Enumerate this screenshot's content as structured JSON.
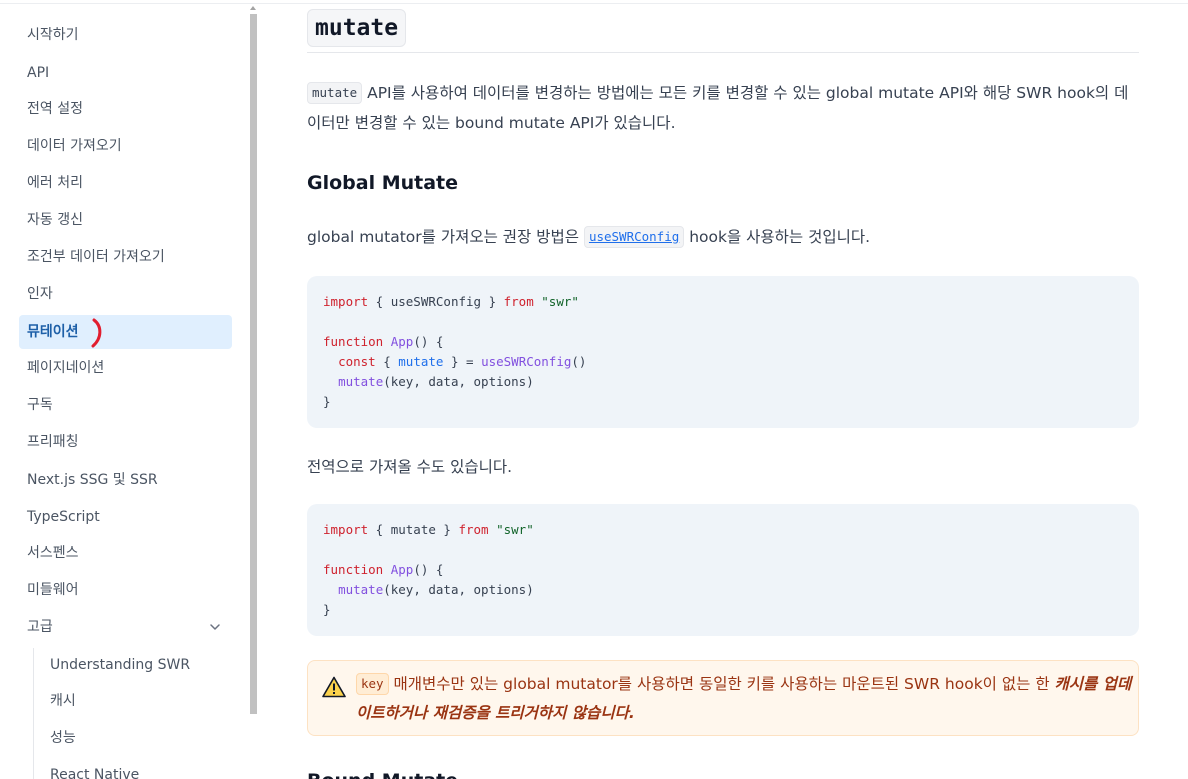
{
  "sidebar": {
    "items": [
      {
        "label": "시작하기"
      },
      {
        "label": "API"
      },
      {
        "label": "전역 설정"
      },
      {
        "label": "데이터 가져오기"
      },
      {
        "label": "에러 처리"
      },
      {
        "label": "자동 갱신"
      },
      {
        "label": "조건부 데이터 가져오기"
      },
      {
        "label": "인자"
      },
      {
        "label": "뮤테이션"
      },
      {
        "label": "페이지네이션"
      },
      {
        "label": "구독"
      },
      {
        "label": "프리패칭"
      },
      {
        "label": "Next.js SSG 및 SSR"
      },
      {
        "label": "TypeScript"
      },
      {
        "label": "서스펜스"
      },
      {
        "label": "미들웨어"
      },
      {
        "label": "고급"
      }
    ],
    "active_item": "뮤테이션",
    "subitems": [
      {
        "label": "Understanding SWR"
      },
      {
        "label": "캐시"
      },
      {
        "label": "성능"
      },
      {
        "label": "React Native"
      }
    ]
  },
  "main": {
    "title": "mutate",
    "intro": {
      "code": "mutate",
      "text": "API를 사용하여 데이터를 변경하는 방법에는 모든 키를 변경할 수 있는 global mutate API와 해당 SWR hook의 데이터만 변경할 수 있는 bound mutate API가 있습니다."
    },
    "global_heading": "Global Mutate",
    "global_para": {
      "before": "global mutator를 가져오는 권장 방법은 ",
      "code": "useSWRConfig",
      "after": " hook을 사용하는 것입니다."
    },
    "code1": {
      "import_kw": "import",
      "import_mid": " { useSWRConfig } ",
      "from_kw": "from",
      "module": "\"swr\"",
      "func_kw": "function",
      "func_name": "App",
      "func_sig": "() {",
      "const_kw": "const",
      "destr_open": " { ",
      "destr_var": "mutate",
      "destr_close": " } = ",
      "hook_call": "useSWRConfig",
      "hook_parens": "()",
      "call_name": "mutate",
      "call_args": "(key, data, options)",
      "close": "}"
    },
    "global_para2": "전역으로 가져올 수도 있습니다.",
    "code2": {
      "import_kw": "import",
      "import_mid": " { mutate } ",
      "from_kw": "from",
      "module": "\"swr\"",
      "func_kw": "function",
      "func_name": "App",
      "func_sig": "() {",
      "call_name": "mutate",
      "call_args": "(key, data, options)",
      "close": "}"
    },
    "callout": {
      "code": "key",
      "text": " 매개변수만 있는 global mutator를 사용하면 동일한 키를 사용하는 마운트된 SWR hook이 없는 한 ",
      "emphasis": "캐시를 업데이트하거나 재검증을 트리거하지 않습니다."
    },
    "next_heading": "Bound Mutate"
  },
  "colors": {
    "accent": "#1e60a8",
    "active_bg": "#e0effe",
    "code_bg": "#eff4f9",
    "warning_bg": "#fff7ed",
    "warning_text": "#9a3412"
  }
}
